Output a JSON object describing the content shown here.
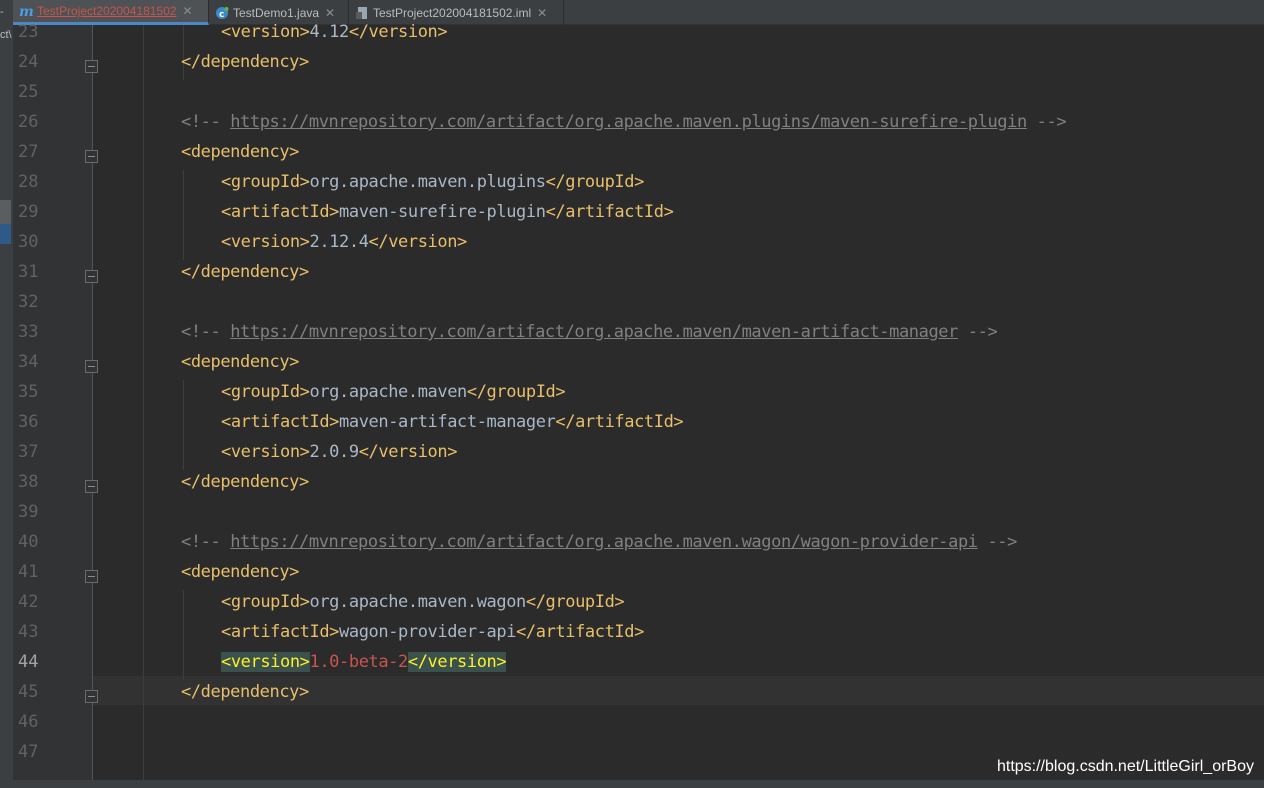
{
  "tabs": [
    {
      "label": "TestProject202004181502",
      "icon": "maven-m-icon",
      "modified": true,
      "active": true
    },
    {
      "label": "TestDemo1.java",
      "icon": "java-class-icon",
      "modified": false,
      "active": false
    },
    {
      "label": "TestProject202004181502.iml",
      "icon": "iml-file-icon",
      "modified": false,
      "active": false
    }
  ],
  "left_strip_text": "ct\\",
  "lines": [
    {
      "num": "23",
      "indent": 3,
      "parts": [
        [
          "tag",
          "<version>"
        ],
        [
          "val",
          "4.12"
        ],
        [
          "tag",
          "</version>"
        ]
      ]
    },
    {
      "num": "24",
      "indent": 2,
      "fold": true,
      "parts": [
        [
          "tag",
          "</dependency>"
        ]
      ]
    },
    {
      "num": "25",
      "indent": 0,
      "parts": []
    },
    {
      "num": "26",
      "indent": 2,
      "parts": [
        [
          "cmt",
          "<!-- "
        ],
        [
          "url",
          "https://mvnrepository.com/artifact/org.apache.maven.plugins/maven-surefire-plugin"
        ],
        [
          "cmt",
          " -->"
        ]
      ]
    },
    {
      "num": "27",
      "indent": 2,
      "fold": true,
      "parts": [
        [
          "tag",
          "<dependency>"
        ]
      ]
    },
    {
      "num": "28",
      "indent": 3,
      "parts": [
        [
          "tag",
          "<groupId>"
        ],
        [
          "val",
          "org.apache.maven.plugins"
        ],
        [
          "tag",
          "</groupId>"
        ]
      ]
    },
    {
      "num": "29",
      "indent": 3,
      "parts": [
        [
          "tag",
          "<artifactId>"
        ],
        [
          "val",
          "maven-surefire-plugin"
        ],
        [
          "tag",
          "</artifactId>"
        ]
      ]
    },
    {
      "num": "30",
      "indent": 3,
      "parts": [
        [
          "tag",
          "<version>"
        ],
        [
          "val",
          "2.12.4"
        ],
        [
          "tag",
          "</version>"
        ]
      ]
    },
    {
      "num": "31",
      "indent": 2,
      "fold": true,
      "parts": [
        [
          "tag",
          "</dependency>"
        ]
      ]
    },
    {
      "num": "32",
      "indent": 0,
      "parts": []
    },
    {
      "num": "33",
      "indent": 2,
      "parts": [
        [
          "cmt",
          "<!-- "
        ],
        [
          "url",
          "https://mvnrepository.com/artifact/org.apache.maven/maven-artifact-manager"
        ],
        [
          "cmt",
          " -->"
        ]
      ]
    },
    {
      "num": "34",
      "indent": 2,
      "fold": true,
      "parts": [
        [
          "tag",
          "<dependency>"
        ]
      ]
    },
    {
      "num": "35",
      "indent": 3,
      "parts": [
        [
          "tag",
          "<groupId>"
        ],
        [
          "val",
          "org.apache.maven"
        ],
        [
          "tag",
          "</groupId>"
        ]
      ]
    },
    {
      "num": "36",
      "indent": 3,
      "parts": [
        [
          "tag",
          "<artifactId>"
        ],
        [
          "val",
          "maven-artifact-manager"
        ],
        [
          "tag",
          "</artifactId>"
        ]
      ]
    },
    {
      "num": "37",
      "indent": 3,
      "parts": [
        [
          "tag",
          "<version>"
        ],
        [
          "val",
          "2.0.9"
        ],
        [
          "tag",
          "</version>"
        ]
      ]
    },
    {
      "num": "38",
      "indent": 2,
      "fold": true,
      "parts": [
        [
          "tag",
          "</dependency>"
        ]
      ]
    },
    {
      "num": "39",
      "indent": 0,
      "parts": []
    },
    {
      "num": "40",
      "indent": 2,
      "parts": [
        [
          "cmt",
          "<!-- "
        ],
        [
          "url",
          "https://mvnrepository.com/artifact/org.apache.maven.wagon/wagon-provider-api"
        ],
        [
          "cmt",
          " -->"
        ]
      ]
    },
    {
      "num": "41",
      "indent": 2,
      "fold": true,
      "parts": [
        [
          "tag",
          "<dependency>"
        ]
      ]
    },
    {
      "num": "42",
      "indent": 3,
      "parts": [
        [
          "tag",
          "<groupId>"
        ],
        [
          "val",
          "org.apache.maven.wagon"
        ],
        [
          "tag",
          "</groupId>"
        ]
      ]
    },
    {
      "num": "43",
      "indent": 3,
      "parts": [
        [
          "tag",
          "<artifactId>"
        ],
        [
          "val",
          "wagon-provider-api"
        ],
        [
          "tag",
          "</artifactId>"
        ]
      ]
    },
    {
      "num": "44",
      "indent": 3,
      "current": true,
      "parts": [
        [
          "hl-tag",
          "<version>"
        ],
        [
          "red",
          "1.0-beta-2"
        ],
        [
          "hl-tag",
          "</version>"
        ]
      ]
    },
    {
      "num": "45",
      "indent": 2,
      "fold": true,
      "parts": [
        [
          "tag",
          "</dependency>"
        ]
      ]
    },
    {
      "num": "46",
      "indent": 0,
      "parts": []
    },
    {
      "num": "47",
      "indent": 0,
      "parts": []
    }
  ],
  "watermark": "https://blog.csdn.net/LittleGirl_orBoy"
}
